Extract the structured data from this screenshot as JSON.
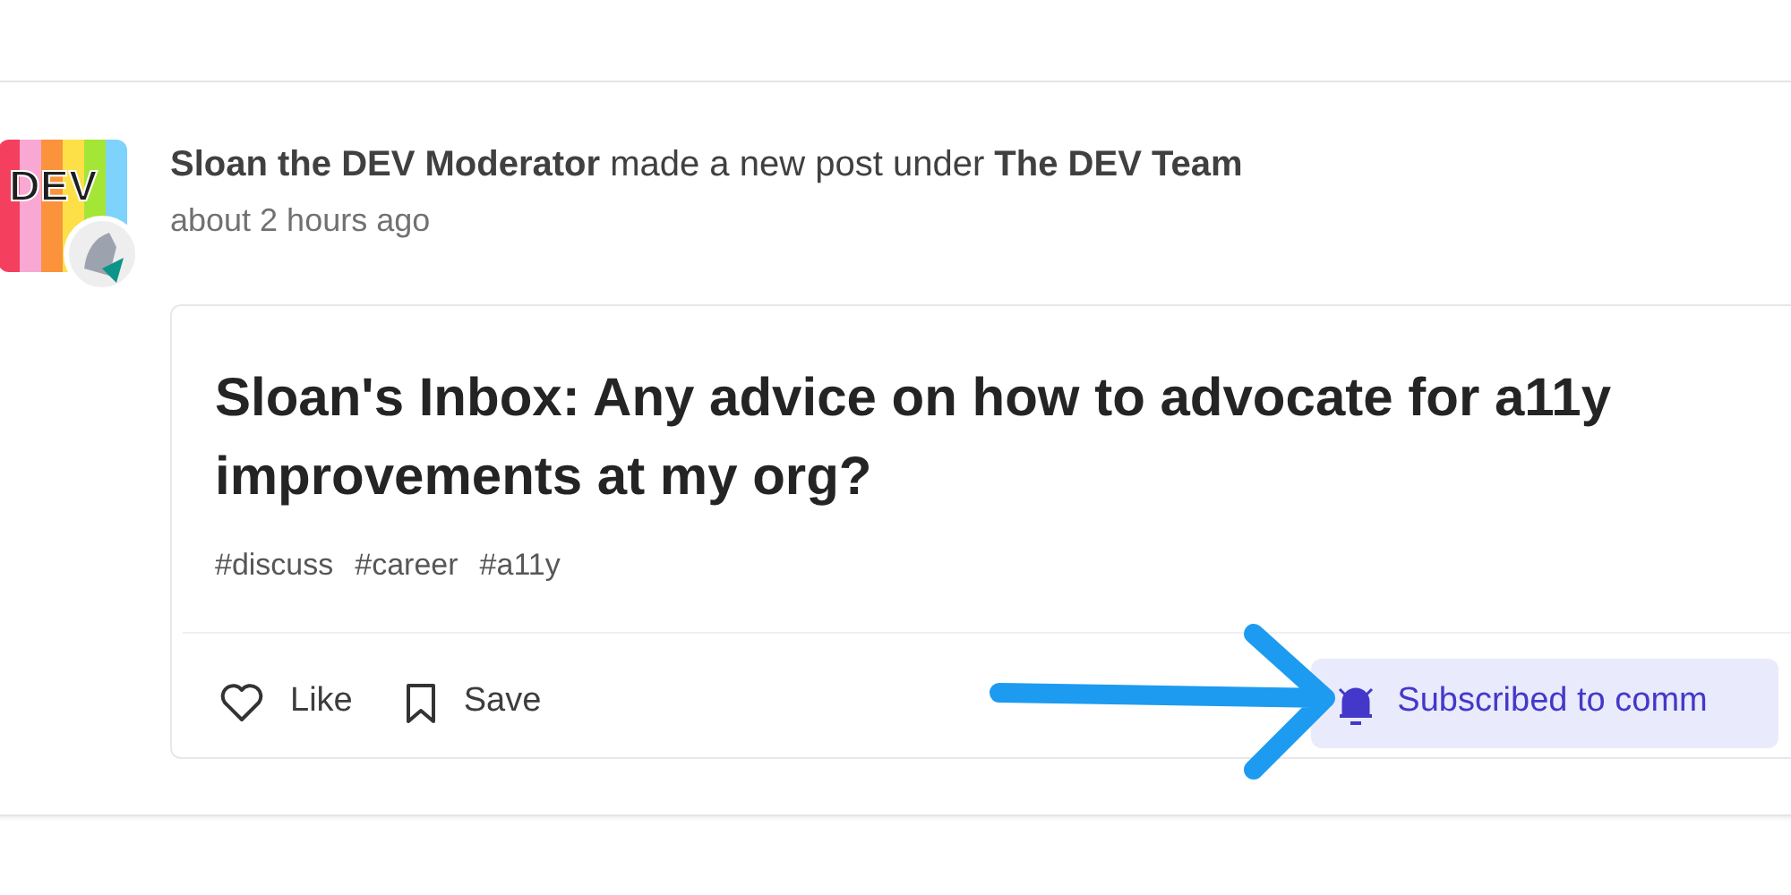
{
  "post": {
    "author": "Sloan the DEV Moderator",
    "action": "made a new post under",
    "team": "The DEV Team",
    "time": "about 2 hours ago",
    "avatar_text": "DEV",
    "title": "Sloan's Inbox: Any advice on how to advocate for a11y improvements at my org?",
    "tags": [
      "#discuss",
      "#career",
      "#a11y"
    ],
    "actions": [
      {
        "kind": "like",
        "label": "Like"
      },
      {
        "kind": "save",
        "label": "Save"
      }
    ],
    "subscribe": {
      "label": "Subscribed to comm",
      "on": true
    }
  }
}
